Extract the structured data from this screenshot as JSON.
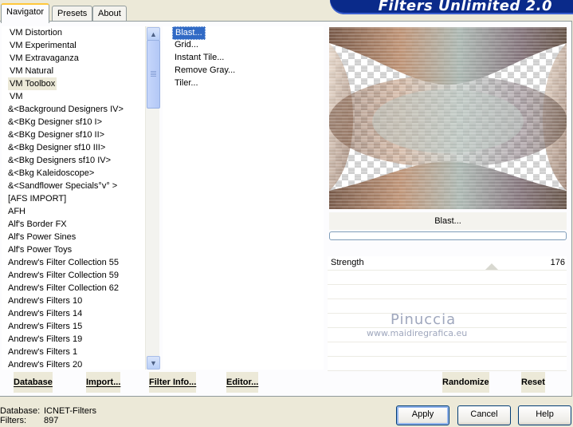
{
  "tabs": [
    "Navigator",
    "Presets",
    "About"
  ],
  "header": {
    "title": "Filters Unlimited 2.0"
  },
  "categories": [
    "VM Distortion",
    "VM Experimental",
    "VM Extravaganza",
    "VM Natural",
    "VM Toolbox",
    "VM",
    "&<Background Designers IV>",
    "&<BKg Designer sf10 I>",
    "&<BKg Designer sf10 II>",
    "&<Bkg Designer sf10 III>",
    "&<Bkg Designers sf10 IV>",
    "&<Bkg Kaleidoscope>",
    "&<Sandflower Specials°v° >",
    "[AFS IMPORT]",
    "AFH",
    "Alf's Border FX",
    "Alf's Power Sines",
    "Alf's Power Toys",
    "Andrew's Filter Collection 55",
    "Andrew's Filter Collection 59",
    "Andrew's Filter Collection 62",
    "Andrew's Filters 10",
    "Andrew's Filters 14",
    "Andrew's Filters 15",
    "Andrew's Filters 19",
    "Andrew's Filters 1",
    "Andrew's Filters 20"
  ],
  "selected_category": "VM Toolbox",
  "filters": [
    "Blast...",
    "Grid...",
    "Instant Tile...",
    "Remove Gray...",
    "Tiler..."
  ],
  "selected_filter": "Blast...",
  "filter_name": "Blast...",
  "params": [
    {
      "label": "Strength",
      "value": "176"
    }
  ],
  "bottom_buttons": {
    "database": "Database",
    "import": "Import...",
    "filter_info": "Filter Info...",
    "editor": "Editor...",
    "randomize": "Randomize",
    "reset": "Reset"
  },
  "status": {
    "database_label": "Database:",
    "database_value": "ICNET-Filters",
    "filters_label": "Filters:",
    "filters_value": "897"
  },
  "dialog_buttons": {
    "apply": "Apply",
    "cancel": "Cancel",
    "help": "Help"
  },
  "watermark": {
    "name": "Pinuccia",
    "url": "www.maidiregrafica.eu"
  },
  "icons": {
    "scroll_up": "▲",
    "scroll_down": "▼"
  },
  "colors": {
    "banner": "#0a2a8a",
    "selection": "#316ac5",
    "tab_highlight": "#ffc83c"
  }
}
